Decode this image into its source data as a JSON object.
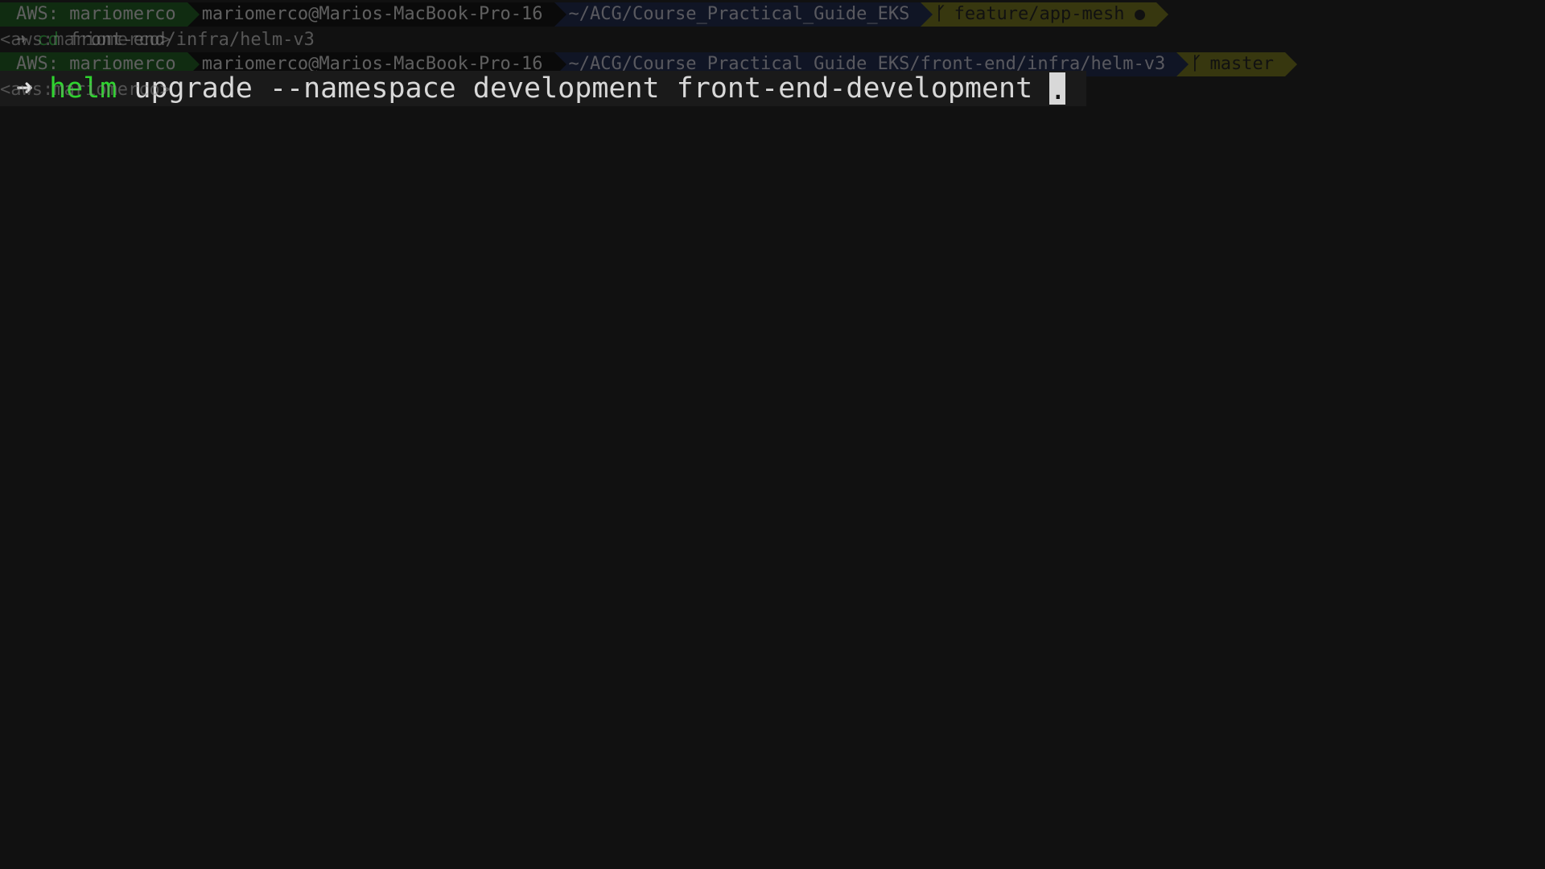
{
  "prompt1": {
    "aws": "AWS: mariomerco",
    "user": "mariomerco@Marios-MacBook-Pro-16",
    "dir": "~/ACG/Course_Practical_Guide_EKS",
    "branch": "feature/app-mesh",
    "branch_icon": "git-branch-icon"
  },
  "history_line": {
    "arrow": "➜",
    "command": "cd",
    "args": "front-end/infra/helm-v3",
    "rprompt": "<aws:mariomerco>"
  },
  "prompt2": {
    "aws": "AWS: mariomerco",
    "user": "mariomerco@Marios-MacBook-Pro-16",
    "dir": "~/ACG/Course_Practical_Guide_EKS/front-end/infra/helm-v3",
    "branch": "master",
    "branch_icon": "git-branch-icon"
  },
  "active_line": {
    "arrow": "➜",
    "command": "helm",
    "args": "upgrade --namespace development front-end-development",
    "cursor_char": ".",
    "rprompt": "<aws:mariomerco>"
  },
  "colors": {
    "background": "#111111",
    "aws_segment": "#0f5e12",
    "user_segment": "#000000",
    "dir_segment": "#0f1d4a",
    "git_segment": "#7c7c0e",
    "command_green": "#2fd32f"
  }
}
